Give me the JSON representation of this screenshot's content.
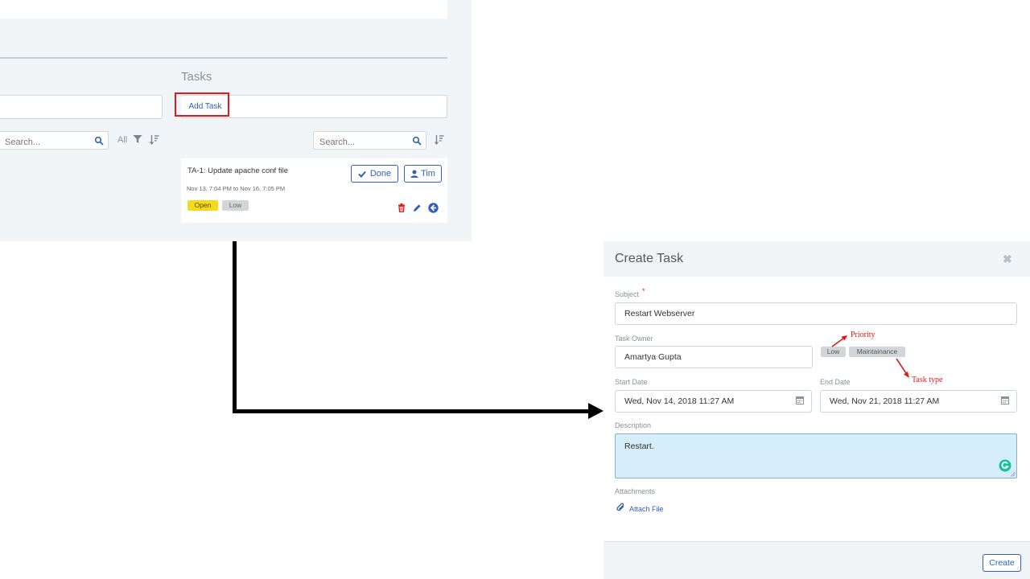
{
  "tasks_panel": {
    "title": "Tasks",
    "add_task_label": "Add Task",
    "left_search_placeholder": "Search...",
    "right_search_placeholder": "Search...",
    "filter_label": "All",
    "task": {
      "title": "TA-1: Update apache conf file",
      "dates": "Nov 13, 7:04 PM to Nov 16, 7:05 PM",
      "done_label": "Done",
      "owner_label": "Tim",
      "status_badge": "Open",
      "priority_badge": "Low"
    }
  },
  "modal": {
    "title": "Create Task",
    "subject_label": "Subject",
    "subject_required": "*",
    "subject_value": "Restart Webserver",
    "owner_label": "Task Owner",
    "owner_value": "Amartya Gupta",
    "priority_tag": "Low",
    "type_tag": "Maintainance",
    "start_label": "Start Date",
    "start_value": "Wed, Nov 14, 2018 11:27 AM",
    "end_label": "End Date",
    "end_value": "Wed, Nov 21, 2018 11:27 AM",
    "description_label": "Description",
    "description_value": "Restart.",
    "attachments_label": "Attachments",
    "attach_link": "Attach File",
    "create_label": "Create"
  },
  "annotations": {
    "priority": "Priority",
    "task_type": "Task type"
  },
  "colors": {
    "accent": "#2f5fbf",
    "highlight": "#e01b1b",
    "open_badge": "#f7d91b",
    "description_bg": "#d6edfa"
  }
}
